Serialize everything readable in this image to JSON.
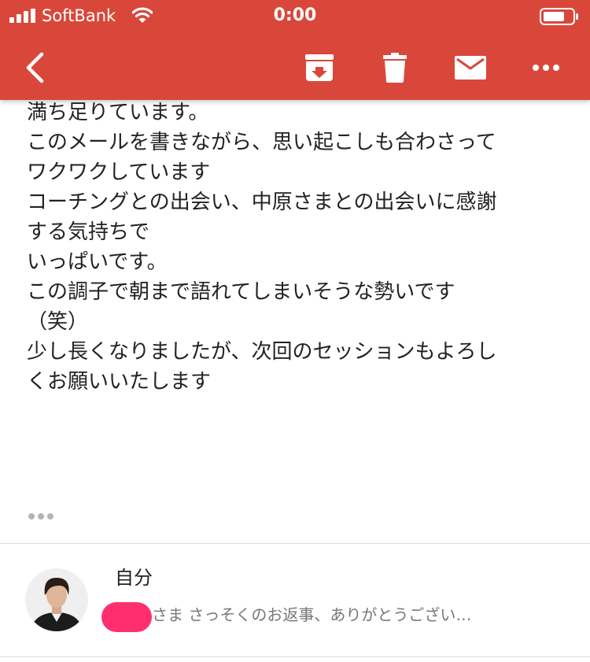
{
  "status_bar": {
    "carrier": "SoftBank",
    "time": "0:00"
  },
  "toolbar": {
    "back_icon": "chevron-left-icon",
    "actions": [
      "archive-icon",
      "trash-icon",
      "mail-icon",
      "more-horizontal-icon"
    ]
  },
  "message": {
    "lines": [
      "満ち足りています。",
      "",
      "このメールを書きながら、思い起こしも合わさって",
      "ワクワクしています",
      "コーチングとの出会い、中原さまとの出会いに感謝",
      "する気持ちで",
      "いっぱいです。",
      "",
      "この調子で朝まで語れてしまいそうな勢いです",
      "（笑）",
      "",
      "少し長くなりましたが、次回のセッションもよろし",
      "くお願いいたします"
    ],
    "show_trimmed_icon": "ellipsis-icon"
  },
  "reply": {
    "sender": "自分",
    "snippet": "さま さっそくのお返事、ありがとうござい…"
  },
  "colors": {
    "appbar": "#d9473b",
    "redaction": "#ff2f6e"
  }
}
